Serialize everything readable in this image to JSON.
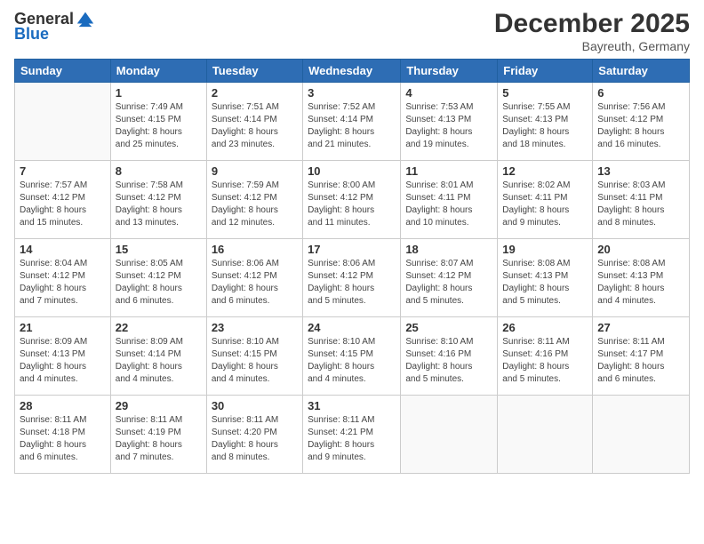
{
  "header": {
    "logo_general": "General",
    "logo_blue": "Blue",
    "month_title": "December 2025",
    "location": "Bayreuth, Germany"
  },
  "weekdays": [
    "Sunday",
    "Monday",
    "Tuesday",
    "Wednesday",
    "Thursday",
    "Friday",
    "Saturday"
  ],
  "weeks": [
    [
      {
        "day": "",
        "info": ""
      },
      {
        "day": "1",
        "info": "Sunrise: 7:49 AM\nSunset: 4:15 PM\nDaylight: 8 hours\nand 25 minutes."
      },
      {
        "day": "2",
        "info": "Sunrise: 7:51 AM\nSunset: 4:14 PM\nDaylight: 8 hours\nand 23 minutes."
      },
      {
        "day": "3",
        "info": "Sunrise: 7:52 AM\nSunset: 4:14 PM\nDaylight: 8 hours\nand 21 minutes."
      },
      {
        "day": "4",
        "info": "Sunrise: 7:53 AM\nSunset: 4:13 PM\nDaylight: 8 hours\nand 19 minutes."
      },
      {
        "day": "5",
        "info": "Sunrise: 7:55 AM\nSunset: 4:13 PM\nDaylight: 8 hours\nand 18 minutes."
      },
      {
        "day": "6",
        "info": "Sunrise: 7:56 AM\nSunset: 4:12 PM\nDaylight: 8 hours\nand 16 minutes."
      }
    ],
    [
      {
        "day": "7",
        "info": "Sunrise: 7:57 AM\nSunset: 4:12 PM\nDaylight: 8 hours\nand 15 minutes."
      },
      {
        "day": "8",
        "info": "Sunrise: 7:58 AM\nSunset: 4:12 PM\nDaylight: 8 hours\nand 13 minutes."
      },
      {
        "day": "9",
        "info": "Sunrise: 7:59 AM\nSunset: 4:12 PM\nDaylight: 8 hours\nand 12 minutes."
      },
      {
        "day": "10",
        "info": "Sunrise: 8:00 AM\nSunset: 4:12 PM\nDaylight: 8 hours\nand 11 minutes."
      },
      {
        "day": "11",
        "info": "Sunrise: 8:01 AM\nSunset: 4:11 PM\nDaylight: 8 hours\nand 10 minutes."
      },
      {
        "day": "12",
        "info": "Sunrise: 8:02 AM\nSunset: 4:11 PM\nDaylight: 8 hours\nand 9 minutes."
      },
      {
        "day": "13",
        "info": "Sunrise: 8:03 AM\nSunset: 4:11 PM\nDaylight: 8 hours\nand 8 minutes."
      }
    ],
    [
      {
        "day": "14",
        "info": "Sunrise: 8:04 AM\nSunset: 4:12 PM\nDaylight: 8 hours\nand 7 minutes."
      },
      {
        "day": "15",
        "info": "Sunrise: 8:05 AM\nSunset: 4:12 PM\nDaylight: 8 hours\nand 6 minutes."
      },
      {
        "day": "16",
        "info": "Sunrise: 8:06 AM\nSunset: 4:12 PM\nDaylight: 8 hours\nand 6 minutes."
      },
      {
        "day": "17",
        "info": "Sunrise: 8:06 AM\nSunset: 4:12 PM\nDaylight: 8 hours\nand 5 minutes."
      },
      {
        "day": "18",
        "info": "Sunrise: 8:07 AM\nSunset: 4:12 PM\nDaylight: 8 hours\nand 5 minutes."
      },
      {
        "day": "19",
        "info": "Sunrise: 8:08 AM\nSunset: 4:13 PM\nDaylight: 8 hours\nand 5 minutes."
      },
      {
        "day": "20",
        "info": "Sunrise: 8:08 AM\nSunset: 4:13 PM\nDaylight: 8 hours\nand 4 minutes."
      }
    ],
    [
      {
        "day": "21",
        "info": "Sunrise: 8:09 AM\nSunset: 4:13 PM\nDaylight: 8 hours\nand 4 minutes."
      },
      {
        "day": "22",
        "info": "Sunrise: 8:09 AM\nSunset: 4:14 PM\nDaylight: 8 hours\nand 4 minutes."
      },
      {
        "day": "23",
        "info": "Sunrise: 8:10 AM\nSunset: 4:15 PM\nDaylight: 8 hours\nand 4 minutes."
      },
      {
        "day": "24",
        "info": "Sunrise: 8:10 AM\nSunset: 4:15 PM\nDaylight: 8 hours\nand 4 minutes."
      },
      {
        "day": "25",
        "info": "Sunrise: 8:10 AM\nSunset: 4:16 PM\nDaylight: 8 hours\nand 5 minutes."
      },
      {
        "day": "26",
        "info": "Sunrise: 8:11 AM\nSunset: 4:16 PM\nDaylight: 8 hours\nand 5 minutes."
      },
      {
        "day": "27",
        "info": "Sunrise: 8:11 AM\nSunset: 4:17 PM\nDaylight: 8 hours\nand 6 minutes."
      }
    ],
    [
      {
        "day": "28",
        "info": "Sunrise: 8:11 AM\nSunset: 4:18 PM\nDaylight: 8 hours\nand 6 minutes."
      },
      {
        "day": "29",
        "info": "Sunrise: 8:11 AM\nSunset: 4:19 PM\nDaylight: 8 hours\nand 7 minutes."
      },
      {
        "day": "30",
        "info": "Sunrise: 8:11 AM\nSunset: 4:20 PM\nDaylight: 8 hours\nand 8 minutes."
      },
      {
        "day": "31",
        "info": "Sunrise: 8:11 AM\nSunset: 4:21 PM\nDaylight: 8 hours\nand 9 minutes."
      },
      {
        "day": "",
        "info": ""
      },
      {
        "day": "",
        "info": ""
      },
      {
        "day": "",
        "info": ""
      }
    ]
  ]
}
